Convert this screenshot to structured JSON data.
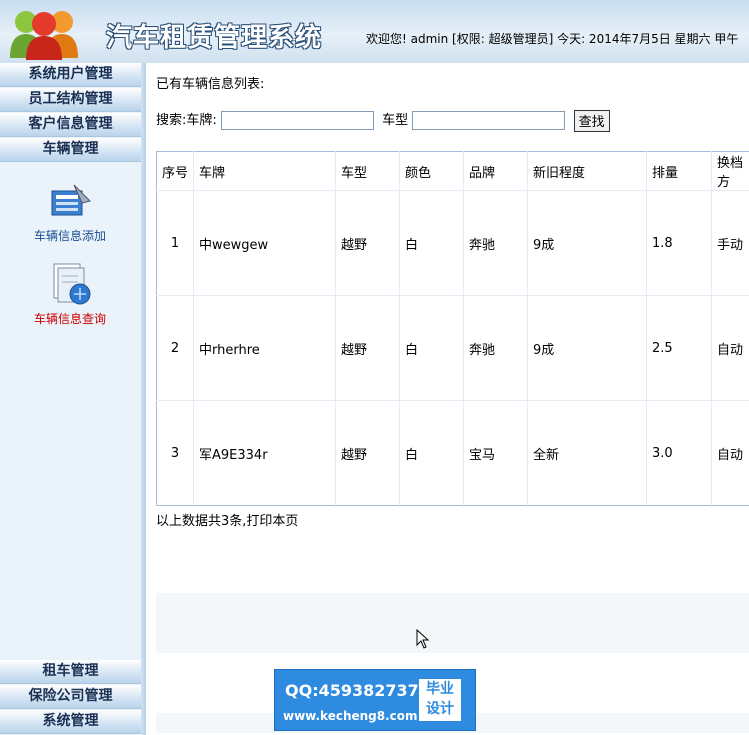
{
  "header": {
    "title": "汽车租赁管理系统",
    "welcome": "欢迎您! admin [权限: 超级管理员] 今天: 2014年7月5日 星期六 甲午"
  },
  "sidebar": {
    "top_menus": [
      "系统用户管理",
      "员工结构管理",
      "客户信息管理",
      "车辆管理"
    ],
    "tools": [
      {
        "label": "车辆信息添加",
        "icon": "add-vehicle-icon"
      },
      {
        "label": "车辆信息查询",
        "icon": "query-vehicle-icon"
      }
    ],
    "bottom_menus": [
      "租车管理",
      "保险公司管理",
      "系统管理"
    ]
  },
  "main": {
    "heading": "已有车辆信息列表:",
    "search": {
      "label": "搜索:车牌:",
      "plate_value": "",
      "type_label": "车型",
      "type_value": "",
      "button": "查找"
    },
    "columns": [
      "序号",
      "车牌",
      "车型",
      "颜色",
      "品牌",
      "新旧程度",
      "排量",
      "换档方"
    ],
    "rows": [
      [
        "1",
        "中wewgew",
        "越野",
        "白",
        "奔驰",
        "9成",
        "1.8",
        "手动"
      ],
      [
        "2",
        "中rherhre",
        "越野",
        "白",
        "奔驰",
        "9成",
        "2.5",
        "自动"
      ],
      [
        "3",
        "军A9E334r",
        "越野",
        "白",
        "宝马",
        "全新",
        "3.0",
        "自动"
      ]
    ],
    "footer": "以上数据共3条,打印本页"
  },
  "watermark": {
    "qq": "QQ:459382737",
    "url": "www.kecheng8.com",
    "tag_line1": "毕业",
    "tag_line2": "设计"
  },
  "colors": {
    "accent": "#2f8be0",
    "header_bg": "#d6e6f4",
    "selected_tool": "#cc0000",
    "tool_link": "#1a4f8f"
  }
}
